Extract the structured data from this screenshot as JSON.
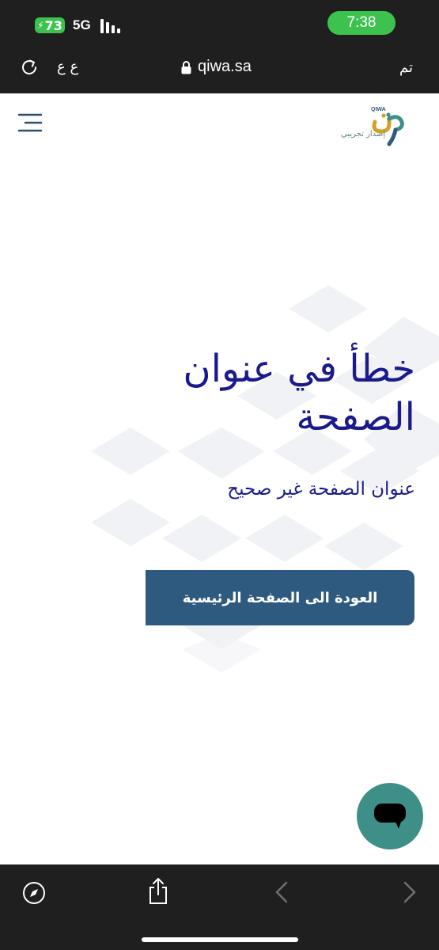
{
  "status_bar": {
    "battery_level": "73",
    "network": "5G",
    "time": "7:38"
  },
  "browser": {
    "text_size_label": "ع ع",
    "url": "qiwa.sa",
    "done_label": "تم"
  },
  "header": {
    "logo_latin": "QIWA",
    "logo_sub": "إصدار تجريبي"
  },
  "error": {
    "title": "خطأ في عنوان الصفحة",
    "subtitle": "عنوان الصفحة غير صحيح",
    "home_button": "العودة الى الصفحة الرئيسية"
  },
  "colors": {
    "title": "#1a1a8c",
    "button": "#2f5a80",
    "chat": "#3d8f88",
    "status_green": "#3ec24f",
    "chrome": "#1f1f1f"
  },
  "icons": {
    "reload": "reload-icon",
    "lock": "lock-icon",
    "menu": "menu-icon",
    "chat": "chat-bubble-icon",
    "compass": "compass-icon",
    "share": "share-icon",
    "back": "chevron-left-icon",
    "forward": "chevron-right-icon"
  }
}
